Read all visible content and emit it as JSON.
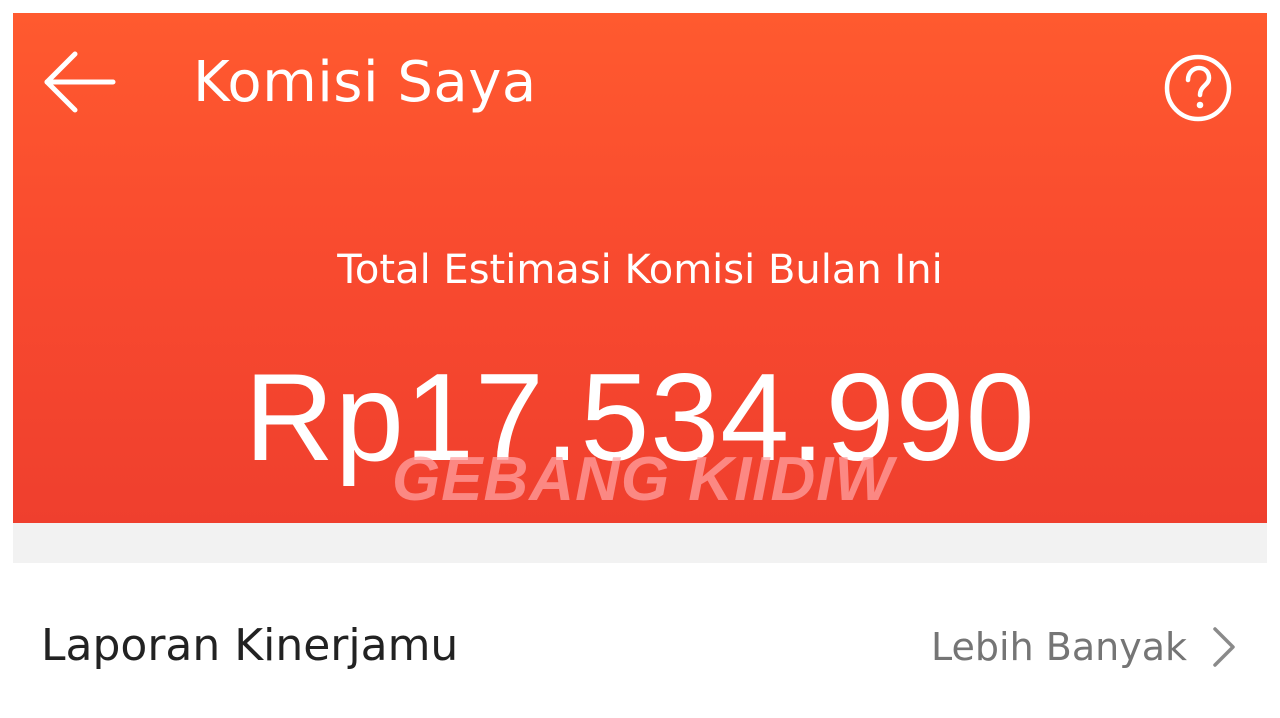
{
  "header": {
    "title": "Komisi Saya",
    "back_icon": "arrow-left-icon",
    "help_icon": "question-circle-icon",
    "background_color": "#f94b2f"
  },
  "summary": {
    "label": "Total Estimasi Komisi Bulan Ini",
    "amount": "Rp17.534.990"
  },
  "watermark": {
    "text": "GEBANG KIIDIW"
  },
  "report": {
    "title": "Laporan Kinerjamu",
    "more_label": "Lebih Banyak",
    "more_icon": "chevron-right-icon"
  },
  "colors": {
    "accent": "#f94b2f",
    "muted_text": "#757575",
    "primary_text": "#222222",
    "divider": "#f2f2f2"
  }
}
